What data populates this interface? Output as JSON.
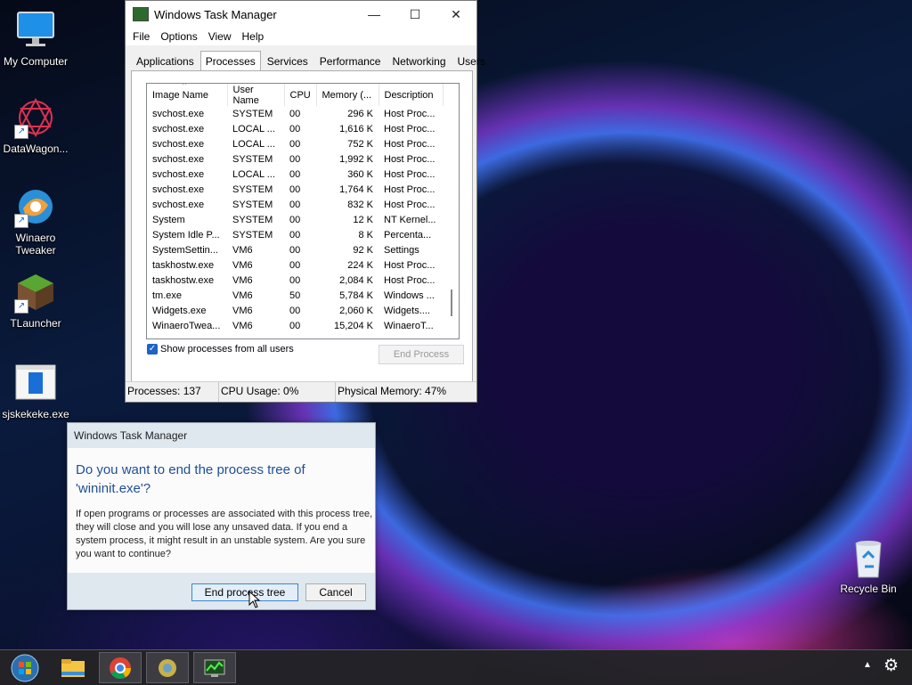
{
  "desktop": {
    "icons": [
      {
        "label": "My Computer"
      },
      {
        "label": "DataWagon..."
      },
      {
        "label": "Winaero Tweaker"
      },
      {
        "label": "TLauncher"
      },
      {
        "label": "sjskekeke.exe"
      },
      {
        "label": "Recycle Bin"
      }
    ]
  },
  "task_manager": {
    "title": "Windows Task Manager",
    "menu": [
      "File",
      "Options",
      "View",
      "Help"
    ],
    "tabs": [
      "Applications",
      "Processes",
      "Services",
      "Performance",
      "Networking",
      "Users"
    ],
    "active_tab": "Processes",
    "columns": [
      "Image Name",
      "User Name",
      "CPU",
      "Memory (...",
      "Description"
    ],
    "rows": [
      [
        "svchost.exe",
        "SYSTEM",
        "00",
        "296 K",
        "Host Proc..."
      ],
      [
        "svchost.exe",
        "LOCAL ...",
        "00",
        "1,616 K",
        "Host Proc..."
      ],
      [
        "svchost.exe",
        "LOCAL ...",
        "00",
        "752 K",
        "Host Proc..."
      ],
      [
        "svchost.exe",
        "SYSTEM",
        "00",
        "1,992 K",
        "Host Proc..."
      ],
      [
        "svchost.exe",
        "LOCAL ...",
        "00",
        "360 K",
        "Host Proc..."
      ],
      [
        "svchost.exe",
        "SYSTEM",
        "00",
        "1,764 K",
        "Host Proc..."
      ],
      [
        "svchost.exe",
        "SYSTEM",
        "00",
        "832 K",
        "Host Proc..."
      ],
      [
        "System",
        "SYSTEM",
        "00",
        "12 K",
        "NT Kernel..."
      ],
      [
        "System Idle P...",
        "SYSTEM",
        "00",
        "8 K",
        "Percenta..."
      ],
      [
        "SystemSettin...",
        "VM6",
        "00",
        "92 K",
        "Settings"
      ],
      [
        "taskhostw.exe",
        "VM6",
        "00",
        "224 K",
        "Host Proc..."
      ],
      [
        "taskhostw.exe",
        "VM6",
        "00",
        "2,084 K",
        "Host Proc..."
      ],
      [
        "tm.exe",
        "VM6",
        "50",
        "5,784 K",
        "Windows ..."
      ],
      [
        "Widgets.exe",
        "VM6",
        "00",
        "2,060 K",
        "Widgets...."
      ],
      [
        "WinaeroTwea...",
        "VM6",
        "00",
        "15,204 K",
        "WinaeroT..."
      ]
    ],
    "show_all_label": "Show processes from all users",
    "show_all_checked": true,
    "end_process_label": "End Process",
    "status": {
      "processes": "Processes: 137",
      "cpu": "CPU Usage: 0%",
      "memory": "Physical Memory: 47%"
    }
  },
  "dialog": {
    "title": "Windows Task Manager",
    "question": "Do you want to end the process tree of 'wininit.exe'?",
    "message": "If open programs or processes are associated with this process tree, they will close and you will lose any unsaved data. If you end a system process, it might result in an unstable system. Are you sure you want to continue?",
    "confirm_label": "End process tree",
    "cancel_label": "Cancel"
  },
  "taskbar": {
    "items": [
      "start-orb-icon",
      "file-explorer-icon",
      "chrome-icon",
      "chrome-alt-icon",
      "task-manager-icon"
    ],
    "tray": [
      "show-hidden-icons-chevron",
      "settings-gear-icon"
    ]
  }
}
